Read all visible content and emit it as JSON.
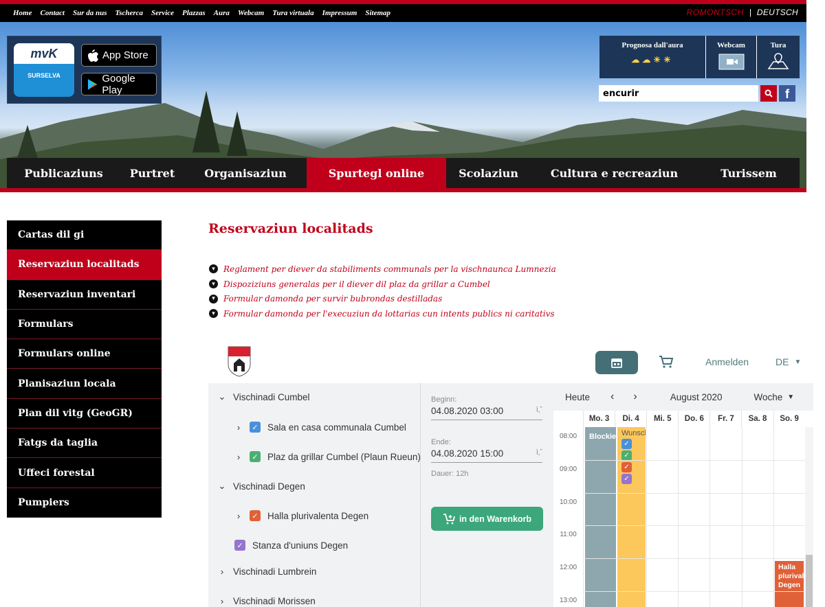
{
  "topnav": {
    "items": [
      "Home",
      "Contact",
      "Sur da nus",
      "Tscherca",
      "Service",
      "Plazzas",
      "Aura",
      "Webcam",
      "Tura virtuala",
      "Impressum",
      "Sitemap"
    ],
    "lang_romontsch": "ROMONTSCH",
    "lang_sep": "|",
    "lang_deutsch": "DEUTSCH"
  },
  "header": {
    "mvk_logo": "mvK",
    "mvk_sub": "SURSELVA",
    "app_store": "App Store",
    "google_play": "Google Play",
    "weather_label": "Prognosa dall'aura",
    "webcam_label": "Webcam",
    "tour_label": "Tura",
    "search_value": "encurir",
    "fb_letter": "f"
  },
  "mainnav": {
    "items": [
      "Publicaziuns",
      "Purtret",
      "Organisaziun",
      "Spurtegl online",
      "Scolaziun",
      "Cultura e recreaziun",
      "Turissem"
    ],
    "active": "Spurtegl online"
  },
  "sidebar": {
    "items": [
      "Cartas dil gi",
      "Reservaziun localitads",
      "Reservaziun inventari",
      "Formulars",
      "Formulars online",
      "Planisaziun locala",
      "Plan dil vitg (GeoGR)",
      "Fatgs da taglia",
      "Uffeci forestal",
      "Pumpiers"
    ],
    "active": "Reservaziun localitads"
  },
  "main": {
    "title": "Reservaziun localitads",
    "links": [
      "Reglament per diever da stabiliments communals per la vischnaunca Lumnezia",
      "Dispoziziuns generalas per il diever dil plaz da grillar a Cumbel",
      "Formular damonda per survir bubrondas destilladas",
      "Formular damonda per l'execuziun da lottarias cun intents publics ni caritativs"
    ]
  },
  "booking": {
    "login": "Anmelden",
    "lang": "DE",
    "tree": [
      {
        "label": "Vischinadi Cumbel",
        "caret": "down",
        "checkbox": null
      },
      {
        "label": "Sala en casa communala Cumbel",
        "caret": "right",
        "checkbox": "#4a90d9"
      },
      {
        "label": "Plaz da grillar Cumbel (Plaun Rueun)",
        "caret": "right",
        "checkbox": "#4caf72"
      },
      {
        "label": "Vischinadi Degen",
        "caret": "down",
        "checkbox": null
      },
      {
        "label": "Halla plurivalenta Degen",
        "caret": "right",
        "checkbox": "#e06037"
      },
      {
        "label": "Stanza d'uniuns Degen",
        "caret": "none",
        "checkbox": "#9575cd"
      },
      {
        "label": "Vischinadi Lumbrein",
        "caret": "right",
        "checkbox": null
      },
      {
        "label": "Vischinadi Morissen",
        "caret": "right",
        "checkbox": null
      }
    ],
    "begin_label": "Beginn:",
    "begin_value": "04.08.2020 03:00",
    "end_label": "Ende:",
    "end_value": "04.08.2020 15:00",
    "duration": "Dauer: 12h",
    "add_to_cart": "in den Warenkorb",
    "calendar": {
      "today": "Heute",
      "month": "August 2020",
      "view": "Woche",
      "days": [
        "Mo. 3",
        "Di. 4",
        "Mi. 5",
        "Do. 6",
        "Fr. 7",
        "Sa. 8",
        "So. 9"
      ],
      "times": [
        "08:00",
        "09:00",
        "10:00",
        "11:00",
        "12:00",
        "13:00"
      ],
      "event_blocked": "Blockiert",
      "event_wish": "Wunsch",
      "event_halla": "Halla plurivalenta Degen",
      "wish_colors": [
        "#4a90d9",
        "#4caf72",
        "#e06037",
        "#9575cd"
      ]
    }
  }
}
